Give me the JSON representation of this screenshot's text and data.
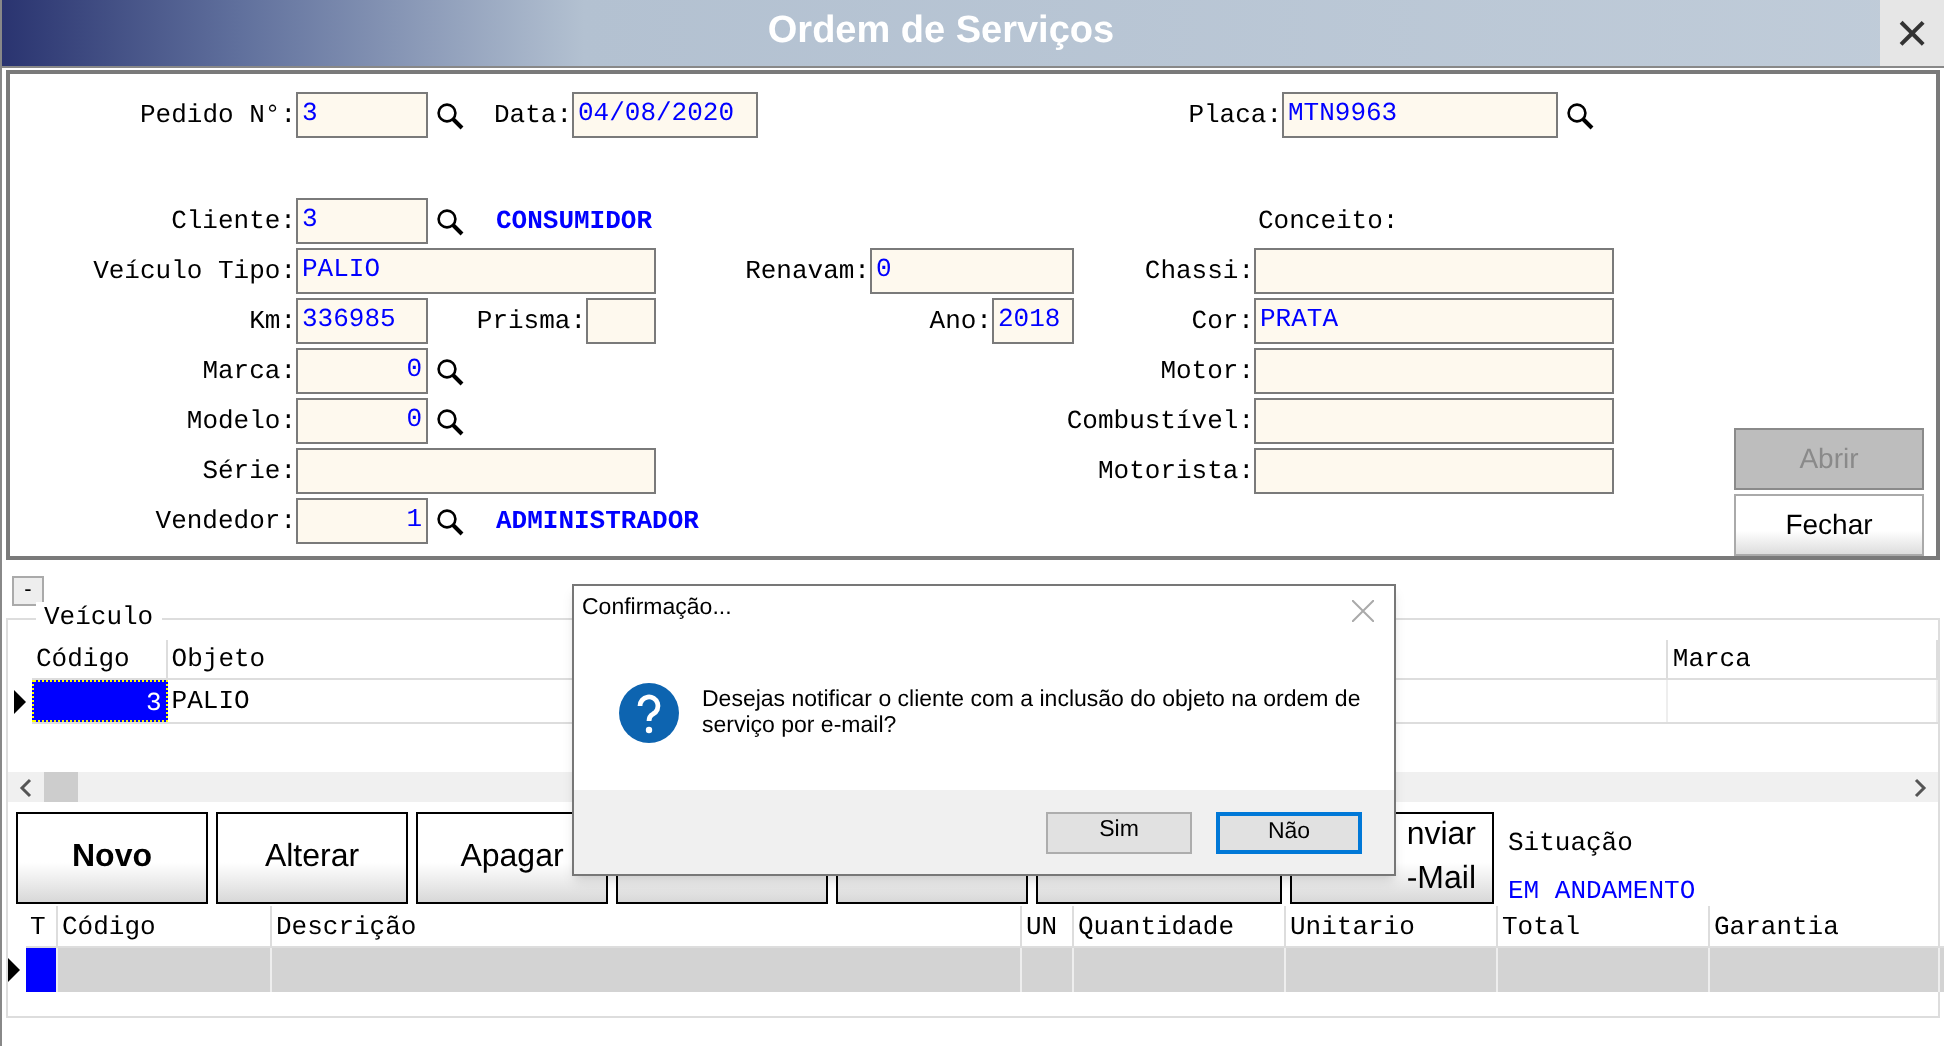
{
  "window": {
    "title": "Ordem de Serviços",
    "close": "×"
  },
  "form": {
    "pedido": {
      "label": "Pedido N°:",
      "value": "3"
    },
    "data": {
      "label": "Data:",
      "value": "04/08/2020"
    },
    "placa": {
      "label": "Placa:",
      "value": "MTN9963"
    },
    "cliente": {
      "label": "Cliente:",
      "value": "3",
      "name": "CONSUMIDOR"
    },
    "conceito": {
      "label": "Conceito:"
    },
    "veiculo_tipo": {
      "label": "Veículo Tipo:",
      "value": "PALIO"
    },
    "renavam": {
      "label": "Renavam:",
      "value": "0"
    },
    "chassi": {
      "label": "Chassi:"
    },
    "km": {
      "label": "Km:",
      "value": "336985"
    },
    "prisma": {
      "label": "Prisma:"
    },
    "ano": {
      "label": "Ano:",
      "value": "2018"
    },
    "cor": {
      "label": "Cor:",
      "value": "PRATA"
    },
    "marca": {
      "label": "Marca:",
      "value": "0"
    },
    "motor": {
      "label": "Motor:"
    },
    "modelo": {
      "label": "Modelo:",
      "value": "0"
    },
    "combustivel": {
      "label": "Combustível:"
    },
    "serie": {
      "label": "Série:"
    },
    "motorista": {
      "label": "Motorista:"
    },
    "vendedor": {
      "label": "Vendedor:",
      "value": "1",
      "name": "ADMINISTRADOR"
    }
  },
  "side_buttons": [
    {
      "label": "Abrir",
      "disabled": true
    },
    {
      "label": "Fechar",
      "disabled": false
    }
  ],
  "collapse_button": "-",
  "vehicle_group": {
    "title": "Veículo",
    "columns": [
      "Código",
      "Objeto",
      "Marca"
    ],
    "rows": [
      {
        "cells": [
          "3",
          "PALIO",
          ""
        ],
        "selected": true
      }
    ]
  },
  "action_buttons": [
    {
      "kind": "text",
      "label": "Novo",
      "bold": true
    },
    {
      "kind": "text",
      "label": "Alterar",
      "bold": false
    },
    {
      "kind": "text",
      "label": "Apagar",
      "bold": false
    },
    {
      "kind": "covered"
    },
    {
      "kind": "covered"
    },
    {
      "kind": "covered"
    },
    {
      "kind": "text",
      "lines": [
        "nviar",
        "-Mail"
      ],
      "bold": false
    }
  ],
  "situacao": {
    "label": "Situação",
    "value": "EM ANDAMENTO"
  },
  "items_table": {
    "columns": [
      "T",
      "Código",
      "Descrição",
      "UN",
      "Quantidade",
      "Unitario",
      "Total",
      "Garantia"
    ],
    "rows": [
      {
        "selected": true
      }
    ]
  },
  "dialog": {
    "title": "Confirmação...",
    "message": "Desejas notificar o cliente com a inclusão do objeto na ordem de serviço por e-mail?",
    "buttons": [
      {
        "label": "Sim",
        "selected": false
      },
      {
        "label": "Não",
        "selected": true
      }
    ]
  }
}
